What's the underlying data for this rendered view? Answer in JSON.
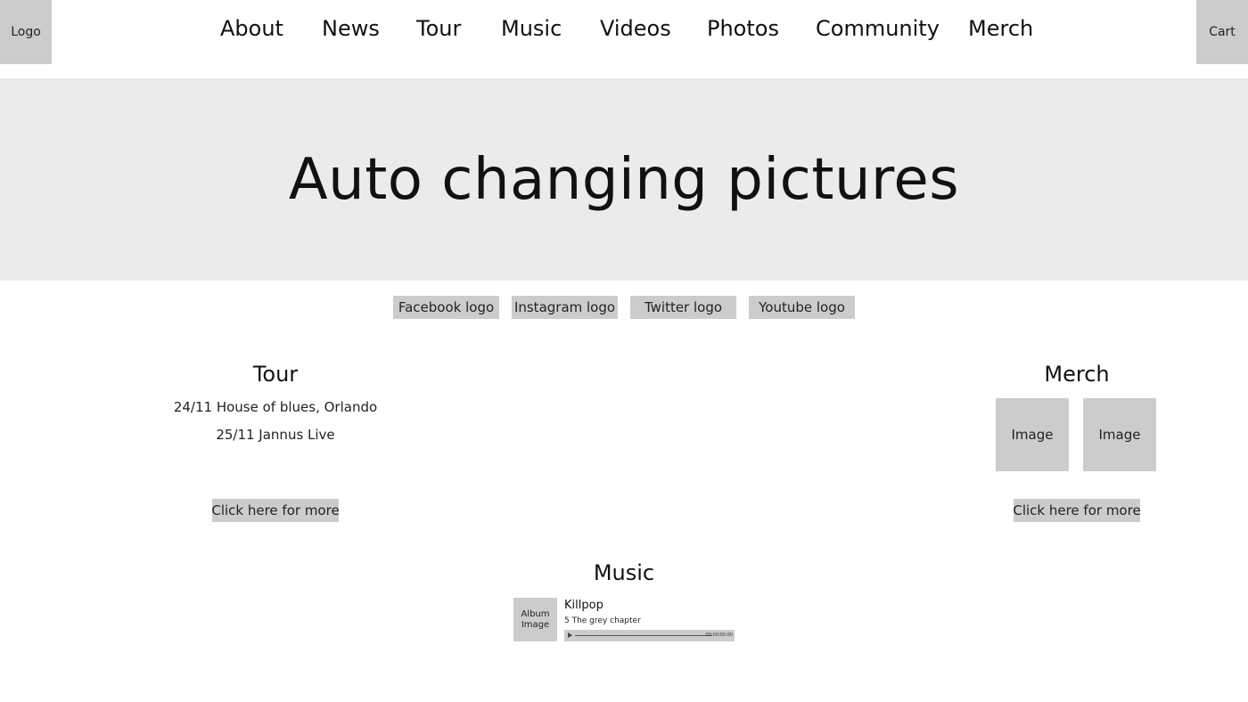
{
  "header": {
    "logo_label": "Logo",
    "cart_label": "Cart",
    "nav": [
      {
        "label": "About"
      },
      {
        "label": "News"
      },
      {
        "label": "Tour"
      },
      {
        "label": "Music"
      },
      {
        "label": "Videos"
      },
      {
        "label": "Photos"
      },
      {
        "label": "Community"
      },
      {
        "label": "Merch"
      }
    ]
  },
  "hero": {
    "title": "Auto changing pictures"
  },
  "social": [
    {
      "label": "Facebook logo"
    },
    {
      "label": "Instagram logo"
    },
    {
      "label": "Twitter logo"
    },
    {
      "label": "Youtube logo"
    }
  ],
  "tour": {
    "title": "Tour",
    "dates": [
      "24/11 House of blues, Orlando",
      "25/11 Jannus Live"
    ],
    "more_label": "Click here for more"
  },
  "merch": {
    "title": "Merch",
    "images": [
      {
        "label": "Image"
      },
      {
        "label": "Image"
      }
    ],
    "more_label": "Click here for more"
  },
  "music": {
    "title": "Music",
    "album_label_line1": "Album",
    "album_label_line2": "Image",
    "artist": "Killpop",
    "track": "5 The grey chapter",
    "time": "00:00/00:00",
    "progress": 0
  },
  "colors": {
    "placeholder_gray": "#cccccc",
    "hero_gray": "#ebebeb"
  }
}
